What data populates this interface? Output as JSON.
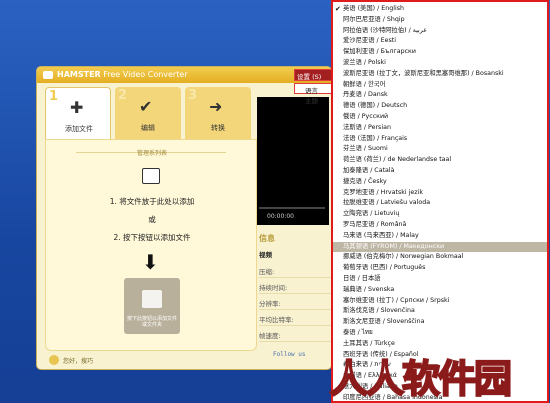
{
  "app": {
    "brand": "HAMSTER",
    "title": "Free Video Converter",
    "steps": [
      {
        "num": "1",
        "label": "添加文件",
        "icon": "plus-icon"
      },
      {
        "num": "2",
        "label": "编辑",
        "icon": "check-icon"
      },
      {
        "num": "3",
        "label": "转换",
        "icon": "arrow-icon"
      }
    ],
    "panel": {
      "title": "管理系列表",
      "line1": "1. 将文件放于此处以添加",
      "or": "或",
      "line2": "2. 按下按钮以添加文件",
      "add_button": "按下此按钮以添加文件或文件夹"
    },
    "footer": "您好，搜巧",
    "preview_time": "00:00:00",
    "info": {
      "title": "信息",
      "section": "视频",
      "rows": [
        "压缩:",
        "持续时间:",
        "分辨率:",
        "平均比特率:",
        "帧速度:"
      ]
    },
    "follow": "Follow us",
    "menu": {
      "settings": "设置 (S)",
      "language": "语言",
      "theme": "主题"
    }
  },
  "languages": [
    {
      "label": "英语 (美国) / English",
      "checked": true
    },
    {
      "label": "阿尔巴尼亚语 / Shqip"
    },
    {
      "label": "阿拉伯语 (沙特阿拉伯) / عربية"
    },
    {
      "label": "爱沙尼亚语 / Eesti"
    },
    {
      "label": "保加利亚语 / Български"
    },
    {
      "label": "波兰语 / Polski"
    },
    {
      "label": "波斯尼亚语 (拉丁文，波斯尼亚和黑塞哥维那) / Bosanski"
    },
    {
      "label": "朝鲜语 / 한국어"
    },
    {
      "label": "丹麦语 / Dansk"
    },
    {
      "label": "德语 (德国) / Deutsch"
    },
    {
      "label": "俄语 / Русский"
    },
    {
      "label": "法斯语 / Persian"
    },
    {
      "label": "法语 (法国) / Français"
    },
    {
      "label": "芬兰语 / Suomi"
    },
    {
      "label": "荷兰语 (荷兰) / de Nederlandse taal"
    },
    {
      "label": "加泰隆语 / Català"
    },
    {
      "label": "捷克语 / Česky"
    },
    {
      "label": "克罗地亚语 / Hrvatski jezik"
    },
    {
      "label": "拉脱维亚语 / Latviešu valoda"
    },
    {
      "label": "立陶宛语 / Lietuvių"
    },
    {
      "label": "罗马尼亚语 / Română"
    },
    {
      "label": "马来语 (马来西亚) / Malay"
    },
    {
      "label": "马其顿语 (FYROM) / Македонски",
      "selected": true
    },
    {
      "label": "挪威语 (伯克梅尔) / Norwegian Bokmaal"
    },
    {
      "label": "葡萄牙语 (巴西) / Português"
    },
    {
      "label": "日语 / 日本語"
    },
    {
      "label": "瑞典语 / Svenska"
    },
    {
      "label": "塞尔维亚语 (拉丁) / Српски / Srpski"
    },
    {
      "label": "斯洛伐克语 / Slovenčina"
    },
    {
      "label": "斯洛文尼亚语 / Slovenščina"
    },
    {
      "label": "泰语 / ไทย"
    },
    {
      "label": "土耳其语 / Türkçe"
    },
    {
      "label": "西班牙语 (传统) / Español"
    },
    {
      "label": "希伯来语 / עברית"
    },
    {
      "label": "希腊语 / Ελληνικά"
    },
    {
      "label": "意大利语 / Italiano"
    },
    {
      "label": "印度尼西亚语 / Bahasa Indonesia"
    }
  ],
  "watermark": "人人软件园",
  "colors": {
    "desktop": "#1a4fa6",
    "highlight": "#e01b1b",
    "app_title": "#e4ae22",
    "selected": "#bfb7a5"
  }
}
